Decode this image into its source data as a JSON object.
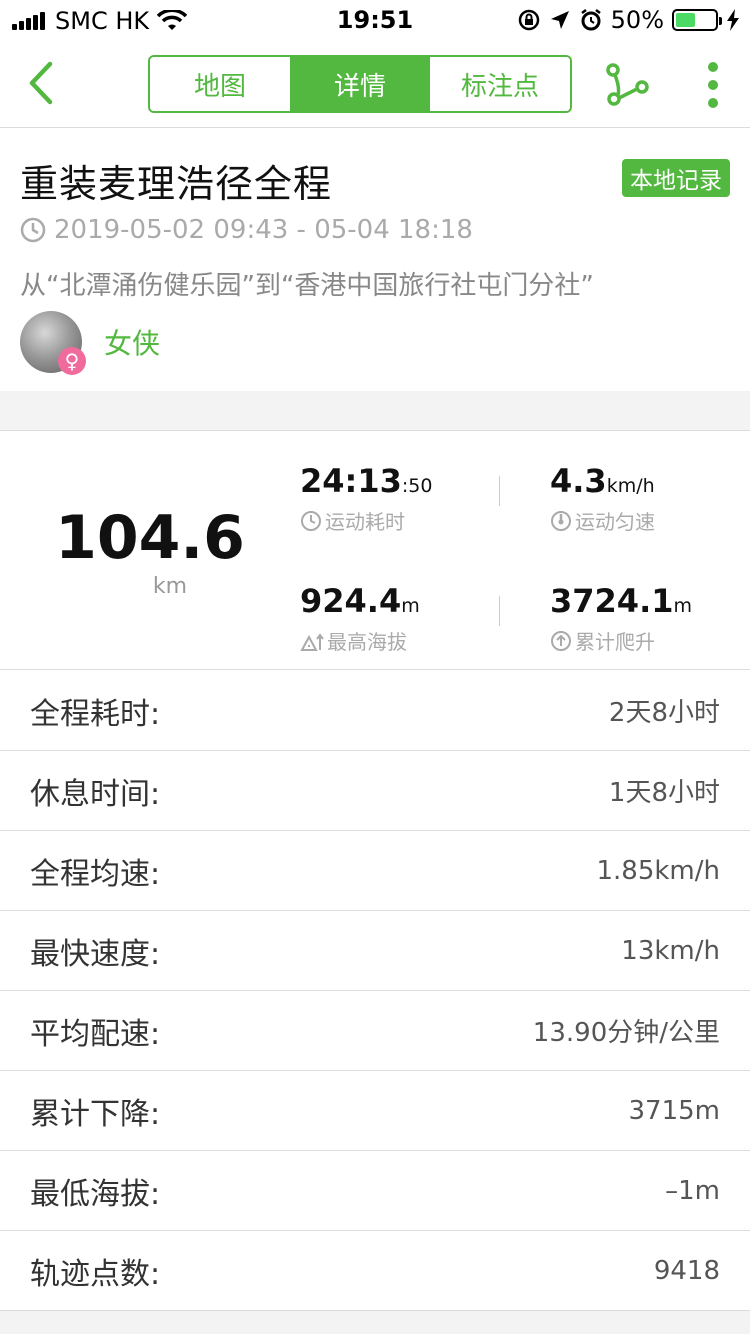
{
  "status_bar": {
    "carrier": "SMC HK",
    "time": "19:51",
    "battery_percent": "50%",
    "battery_level": 0.5
  },
  "nav": {
    "tabs": [
      {
        "label": "地图",
        "active": false
      },
      {
        "label": "详情",
        "active": true
      },
      {
        "label": "标注点",
        "active": false
      }
    ],
    "accent_color": "#53b83f"
  },
  "track": {
    "title": "重装麦理浩径全程",
    "badge": "本地记录",
    "time_range": "2019-05-02 09:43 - 05-04 18:18",
    "route": "从“北潭涌伤健乐园”到“香港中国旅行社屯门分社”",
    "user": {
      "name": "女侠",
      "gender_icon": "♀"
    }
  },
  "stats": {
    "distance": {
      "value": "104.6",
      "unit": "km"
    },
    "moving_time": {
      "value_main": "24:13",
      "value_sub": ":50",
      "label": "运动耗时"
    },
    "avg_speed": {
      "value_main": "4.3",
      "value_sub": "km/h",
      "label": "运动匀速"
    },
    "max_altitude": {
      "value_main": "924.4",
      "value_sub": "m",
      "label": "最高海拔"
    },
    "total_ascent": {
      "value_main": "3724.1",
      "value_sub": "m",
      "label": "累计爬升"
    }
  },
  "details": [
    {
      "label": "全程耗时:",
      "value": "2天8小时"
    },
    {
      "label": "休息时间:",
      "value": "1天8小时"
    },
    {
      "label": "全程均速:",
      "value": "1.85km/h"
    },
    {
      "label": "最快速度:",
      "value": "13km/h"
    },
    {
      "label": "平均配速:",
      "value": "13.90分钟/公里"
    },
    {
      "label": "累计下降:",
      "value": "3715m"
    },
    {
      "label": "最低海拔:",
      "value": "–1m"
    },
    {
      "label": "轨迹点数:",
      "value": "9418"
    }
  ]
}
